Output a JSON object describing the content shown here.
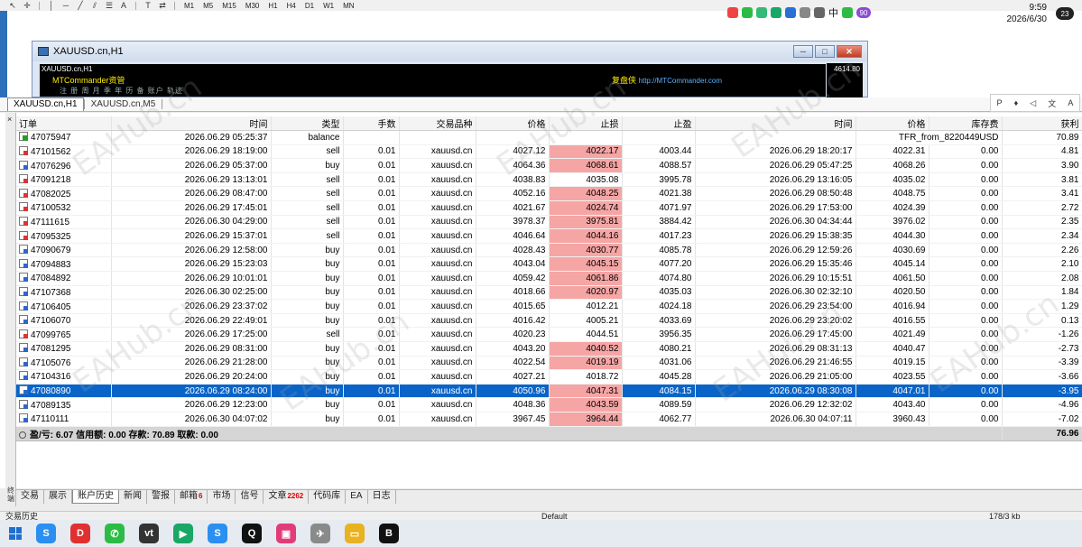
{
  "toolbar": {
    "timeframes": [
      "M1",
      "M5",
      "M15",
      "M30",
      "H1",
      "H4",
      "D1",
      "W1",
      "MN"
    ],
    "tool_icons": [
      "arrow-icon",
      "crosshair-icon",
      "vertical-line-icon",
      "horizontal-line-icon",
      "trendline-icon",
      "fibonacci-icon",
      "channel-icon",
      "text-icon",
      "label-icon",
      "shapes-icon"
    ],
    "tool_glyphs": [
      "↖",
      "✛",
      "│",
      "─",
      "╱",
      "⫽",
      "☰",
      "A",
      "T",
      "⇄"
    ]
  },
  "chart_window": {
    "title": "XAUUSD.cn,H1",
    "inner_symbol": "XAUUSD.cn,H1",
    "mtc_label": "MTCommander资管",
    "menu_text": "注 册 周 月 季 年 历 备 账户      轨迹",
    "copy_label": "复盘侠",
    "copy_url": "http://MTCommander.com",
    "price_label": "4614.80",
    "btn_min": "─",
    "btn_max": "□",
    "btn_close": "✕"
  },
  "chart_tabs": [
    {
      "label": "XAUUSD.cn,H1",
      "active": true
    },
    {
      "label": "XAUUSD.cn,M5",
      "active": false
    }
  ],
  "float_tools": [
    "P",
    "♦",
    "◁",
    "文",
    "A"
  ],
  "terminal": {
    "close_glyph": "×",
    "side_label": "终端",
    "headers": {
      "order": "订单",
      "open_time": "时间",
      "type": "类型",
      "lots": "手数",
      "symbol": "交易品种",
      "open_price": "价格",
      "sl": "止损",
      "tp": "止盈",
      "close_time": "时间",
      "close_price": "价格",
      "swap": "库存费",
      "profit": "获利"
    },
    "balance_row": {
      "order": "47075947",
      "open_time": "2026.06.29 05:25:37",
      "type": "balance",
      "comment": "TFR_from_8220449USD",
      "profit": "70.89"
    },
    "rows": [
      {
        "order": "47101562",
        "open_time": "2026.06.29 18:19:00",
        "type": "sell",
        "lots": "0.01",
        "symbol": "xauusd.cn",
        "open_price": "4027.12",
        "sl": "4022.17",
        "tp": "4003.44",
        "close_time": "2026.06.29 18:20:17",
        "close_price": "4022.31",
        "swap": "0.00",
        "profit": "4.81",
        "sl_hit": true
      },
      {
        "order": "47076296",
        "open_time": "2026.06.29 05:37:00",
        "type": "buy",
        "lots": "0.01",
        "symbol": "xauusd.cn",
        "open_price": "4064.36",
        "sl": "4068.61",
        "tp": "4088.57",
        "close_time": "2026.06.29 05:47:25",
        "close_price": "4068.26",
        "swap": "0.00",
        "profit": "3.90",
        "sl_hit": true
      },
      {
        "order": "47091218",
        "open_time": "2026.06.29 13:13:01",
        "type": "sell",
        "lots": "0.01",
        "symbol": "xauusd.cn",
        "open_price": "4038.83",
        "sl": "4035.08",
        "tp": "3995.78",
        "close_time": "2026.06.29 13:16:05",
        "close_price": "4035.02",
        "swap": "0.00",
        "profit": "3.81",
        "sl_hit": false
      },
      {
        "order": "47082025",
        "open_time": "2026.06.29 08:47:00",
        "type": "sell",
        "lots": "0.01",
        "symbol": "xauusd.cn",
        "open_price": "4052.16",
        "sl": "4048.25",
        "tp": "4021.38",
        "close_time": "2026.06.29 08:50:48",
        "close_price": "4048.75",
        "swap": "0.00",
        "profit": "3.41",
        "sl_hit": true
      },
      {
        "order": "47100532",
        "open_time": "2026.06.29 17:45:01",
        "type": "sell",
        "lots": "0.01",
        "symbol": "xauusd.cn",
        "open_price": "4021.67",
        "sl": "4024.74",
        "tp": "4071.97",
        "close_time": "2026.06.29 17:53:00",
        "close_price": "4024.39",
        "swap": "0.00",
        "profit": "2.72",
        "sl_hit": true
      },
      {
        "order": "47111615",
        "open_time": "2026.06.30 04:29:00",
        "type": "sell",
        "lots": "0.01",
        "symbol": "xauusd.cn",
        "open_price": "3978.37",
        "sl": "3975.81",
        "tp": "3884.42",
        "close_time": "2026.06.30 04:34:44",
        "close_price": "3976.02",
        "swap": "0.00",
        "profit": "2.35",
        "sl_hit": true
      },
      {
        "order": "47095325",
        "open_time": "2026.06.29 15:37:01",
        "type": "sell",
        "lots": "0.01",
        "symbol": "xauusd.cn",
        "open_price": "4046.64",
        "sl": "4044.16",
        "tp": "4017.23",
        "close_time": "2026.06.29 15:38:35",
        "close_price": "4044.30",
        "swap": "0.00",
        "profit": "2.34",
        "sl_hit": true
      },
      {
        "order": "47090679",
        "open_time": "2026.06.29 12:58:00",
        "type": "buy",
        "lots": "0.01",
        "symbol": "xauusd.cn",
        "open_price": "4028.43",
        "sl": "4030.77",
        "tp": "4085.78",
        "close_time": "2026.06.29 12:59:26",
        "close_price": "4030.69",
        "swap": "0.00",
        "profit": "2.26",
        "sl_hit": true
      },
      {
        "order": "47094883",
        "open_time": "2026.06.29 15:23:03",
        "type": "buy",
        "lots": "0.01",
        "symbol": "xauusd.cn",
        "open_price": "4043.04",
        "sl": "4045.15",
        "tp": "4077.20",
        "close_time": "2026.06.29 15:35:46",
        "close_price": "4045.14",
        "swap": "0.00",
        "profit": "2.10",
        "sl_hit": true
      },
      {
        "order": "47084892",
        "open_time": "2026.06.29 10:01:01",
        "type": "buy",
        "lots": "0.01",
        "symbol": "xauusd.cn",
        "open_price": "4059.42",
        "sl": "4061.86",
        "tp": "4074.80",
        "close_time": "2026.06.29 10:15:51",
        "close_price": "4061.50",
        "swap": "0.00",
        "profit": "2.08",
        "sl_hit": true
      },
      {
        "order": "47107368",
        "open_time": "2026.06.30 02:25:00",
        "type": "buy",
        "lots": "0.01",
        "symbol": "xauusd.cn",
        "open_price": "4018.66",
        "sl": "4020.97",
        "tp": "4035.03",
        "close_time": "2026.06.30 02:32:10",
        "close_price": "4020.50",
        "swap": "0.00",
        "profit": "1.84",
        "sl_hit": true
      },
      {
        "order": "47106405",
        "open_time": "2026.06.29 23:37:02",
        "type": "buy",
        "lots": "0.01",
        "symbol": "xauusd.cn",
        "open_price": "4015.65",
        "sl": "4012.21",
        "tp": "4024.18",
        "close_time": "2026.06.29 23:54:00",
        "close_price": "4016.94",
        "swap": "0.00",
        "profit": "1.29",
        "sl_hit": false
      },
      {
        "order": "47106070",
        "open_time": "2026.06.29 22:49:01",
        "type": "buy",
        "lots": "0.01",
        "symbol": "xauusd.cn",
        "open_price": "4016.42",
        "sl": "4005.21",
        "tp": "4033.69",
        "close_time": "2026.06.29 23:20:02",
        "close_price": "4016.55",
        "swap": "0.00",
        "profit": "0.13",
        "sl_hit": false
      },
      {
        "order": "47099765",
        "open_time": "2026.06.29 17:25:00",
        "type": "sell",
        "lots": "0.01",
        "symbol": "xauusd.cn",
        "open_price": "4020.23",
        "sl": "4044.51",
        "tp": "3956.35",
        "close_time": "2026.06.29 17:45:00",
        "close_price": "4021.49",
        "swap": "0.00",
        "profit": "-1.26",
        "sl_hit": false
      },
      {
        "order": "47081295",
        "open_time": "2026.06.29 08:31:00",
        "type": "buy",
        "lots": "0.01",
        "symbol": "xauusd.cn",
        "open_price": "4043.20",
        "sl": "4040.52",
        "tp": "4080.21",
        "close_time": "2026.06.29 08:31:13",
        "close_price": "4040.47",
        "swap": "0.00",
        "profit": "-2.73",
        "sl_hit": true
      },
      {
        "order": "47105076",
        "open_time": "2026.06.29 21:28:00",
        "type": "buy",
        "lots": "0.01",
        "symbol": "xauusd.cn",
        "open_price": "4022.54",
        "sl": "4019.19",
        "tp": "4031.06",
        "close_time": "2026.06.29 21:46:55",
        "close_price": "4019.15",
        "swap": "0.00",
        "profit": "-3.39",
        "sl_hit": true
      },
      {
        "order": "47104316",
        "open_time": "2026.06.29 20:24:00",
        "type": "buy",
        "lots": "0.01",
        "symbol": "xauusd.cn",
        "open_price": "4027.21",
        "sl": "4018.72",
        "tp": "4045.28",
        "close_time": "2026.06.29 21:05:00",
        "close_price": "4023.55",
        "swap": "0.00",
        "profit": "-3.66",
        "sl_hit": false
      },
      {
        "order": "47080890",
        "open_time": "2026.06.29 08:24:00",
        "type": "buy",
        "lots": "0.01",
        "symbol": "xauusd.cn",
        "open_price": "4050.96",
        "sl": "4047.31",
        "tp": "4084.15",
        "close_time": "2026.06.29 08:30:08",
        "close_price": "4047.01",
        "swap": "0.00",
        "profit": "-3.95",
        "sl_hit": true,
        "selected": true
      },
      {
        "order": "47089135",
        "open_time": "2026.06.29 12:23:00",
        "type": "buy",
        "lots": "0.01",
        "symbol": "xauusd.cn",
        "open_price": "4048.36",
        "sl": "4043.59",
        "tp": "4089.59",
        "close_time": "2026.06.29 12:32:02",
        "close_price": "4043.40",
        "swap": "0.00",
        "profit": "-4.96",
        "sl_hit": true
      },
      {
        "order": "47110111",
        "open_time": "2026.06.30 04:07:02",
        "type": "buy",
        "lots": "0.01",
        "symbol": "xauusd.cn",
        "open_price": "3967.45",
        "sl": "3964.44",
        "tp": "4062.77",
        "close_time": "2026.06.30 04:07:11",
        "close_price": "3960.43",
        "swap": "0.00",
        "profit": "-7.02",
        "sl_hit": true
      }
    ],
    "summary": {
      "text": "盈/亏: 6.07  信用额: 0.00  存款: 70.89  取款: 0.00",
      "total": "76.96"
    },
    "tabs": [
      {
        "label": "交易"
      },
      {
        "label": "展示"
      },
      {
        "label": "账户历史",
        "active": true
      },
      {
        "label": "新闻"
      },
      {
        "label": "警报"
      },
      {
        "label": "邮箱",
        "badge": "6"
      },
      {
        "label": "市场"
      },
      {
        "label": "信号"
      },
      {
        "label": "文章",
        "badge": "2262"
      },
      {
        "label": "代码库"
      },
      {
        "label": "EA"
      },
      {
        "label": "日志"
      }
    ]
  },
  "statusbar": {
    "left": "交易历史",
    "middle": "Default",
    "right": "178/3 kb"
  },
  "taskbar": {
    "apps": [
      {
        "name": "app-s-icon",
        "glyph": "S",
        "color": "#2a8ff0"
      },
      {
        "name": "app-d-icon",
        "glyph": "D",
        "color": "#e03030"
      },
      {
        "name": "wechat-icon",
        "glyph": "✆",
        "color": "#2cbc45"
      },
      {
        "name": "app-vt-icon",
        "glyph": "vt",
        "color": "#333333"
      },
      {
        "name": "app-game-icon",
        "glyph": "▶",
        "color": "#19a765"
      },
      {
        "name": "app-s2-icon",
        "glyph": "S",
        "color": "#2a8ff0"
      },
      {
        "name": "qq-icon",
        "glyph": "Q",
        "color": "#111111"
      },
      {
        "name": "app-screen-icon",
        "glyph": "▣",
        "color": "#e23b7a"
      },
      {
        "name": "app-plane-icon",
        "glyph": "✈",
        "color": "#8a8a8a"
      },
      {
        "name": "folder-icon",
        "glyph": "▭",
        "color": "#e8b220"
      },
      {
        "name": "app-b-icon",
        "glyph": "B",
        "color": "#111111"
      }
    ],
    "tray_lang": "中",
    "tray_badge": "90",
    "time": "9:59",
    "date": "2026/6/30",
    "notif": "23"
  },
  "watermark": "EAHub.cn"
}
